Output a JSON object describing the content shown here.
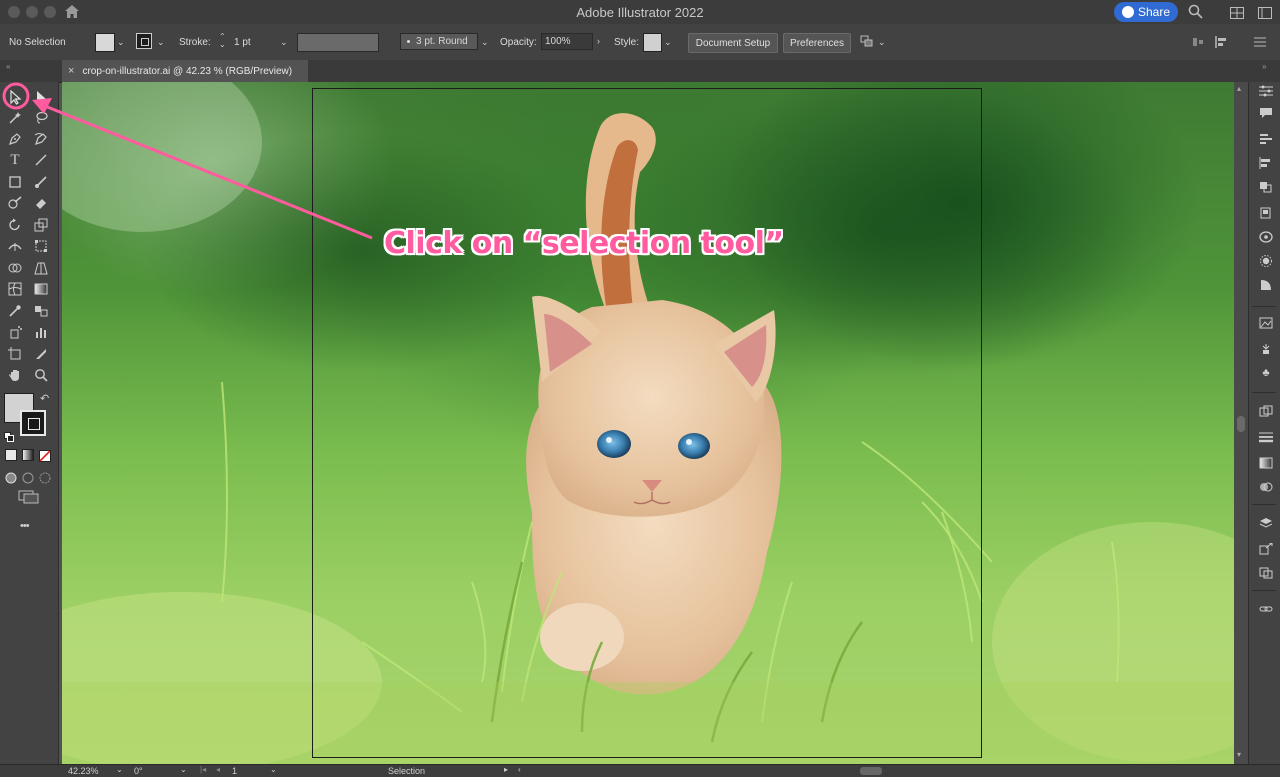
{
  "app": {
    "title": "Adobe Illustrator 2022",
    "share_label": "Share"
  },
  "control_bar": {
    "selection_status": "No Selection",
    "stroke_label": "Stroke:",
    "stroke_weight": "1 pt",
    "brush_label": "3 pt. Round",
    "opacity_label": "Opacity:",
    "opacity_value": "100%",
    "style_label": "Style:",
    "document_setup_label": "Document Setup",
    "preferences_label": "Preferences"
  },
  "document": {
    "tab_title": "crop-on-illustrator.ai @ 42.23 % (RGB/Preview)",
    "close_glyph": "×"
  },
  "annotation": {
    "text": "Click on “selection tool”",
    "color": "#ff5b9e"
  },
  "status_bar": {
    "zoom": "42.23%",
    "rotation": "0°",
    "artboard_number": "1",
    "current_tool": "Selection"
  },
  "toolbar": {
    "more_glyph": "•••"
  },
  "colors": {
    "ui_dark": "#424242",
    "canvas": "#535353",
    "accent_blue": "#2f6bd3",
    "annotation_pink": "#ff5b9e"
  }
}
